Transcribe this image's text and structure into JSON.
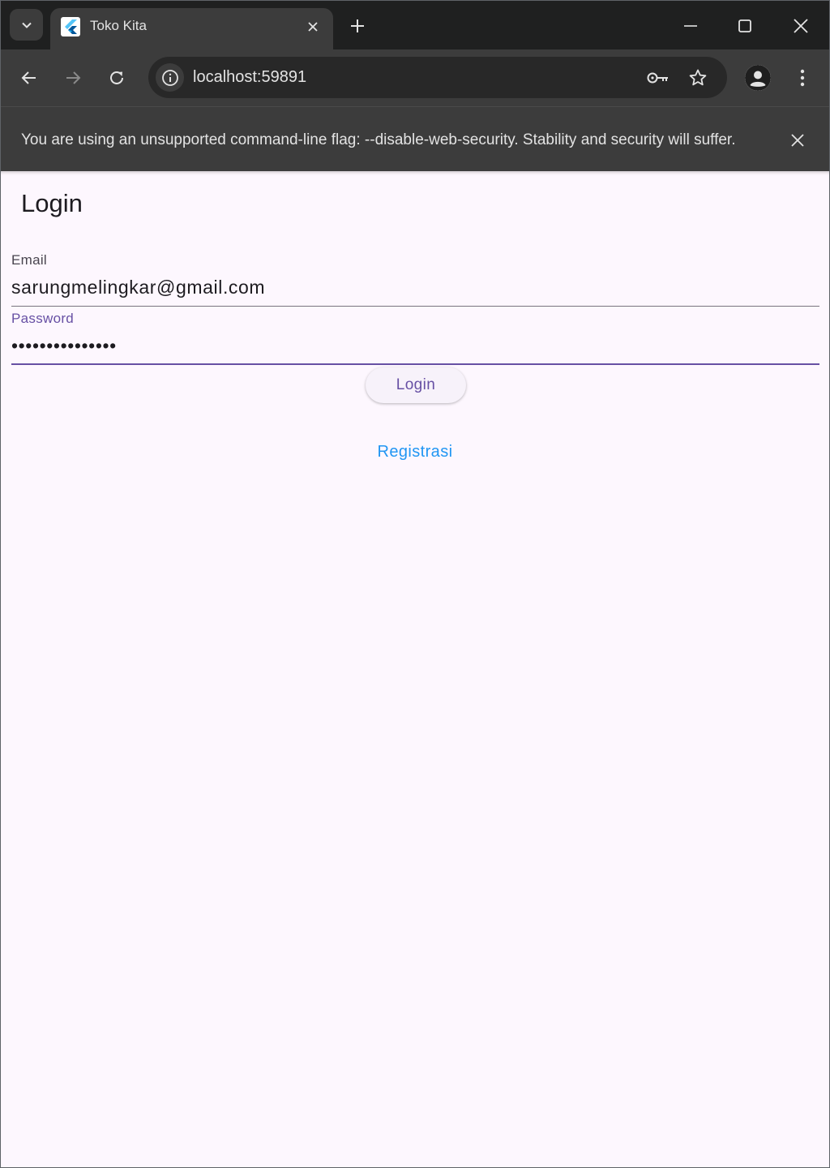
{
  "browser": {
    "tab": {
      "title": "Toko Kita",
      "favicon": "flutter-logo-icon"
    },
    "address_bar": {
      "url": "localhost:59891"
    },
    "infobar": {
      "message": "You are using an unsupported command-line flag: --disable-web-security. Stability and security will suffer."
    }
  },
  "page": {
    "title": "Login",
    "email": {
      "label": "Email",
      "value": "sarungmelingkar@gmail.com"
    },
    "password": {
      "label": "Password",
      "value": "•••••••••••••••"
    },
    "login_button": "Login",
    "register_link": "Registrasi"
  },
  "colors": {
    "primary": "#6750a4",
    "link": "#2196f3",
    "page_background": "#fdf7fe",
    "chrome_dark": "#3c3c3c"
  }
}
